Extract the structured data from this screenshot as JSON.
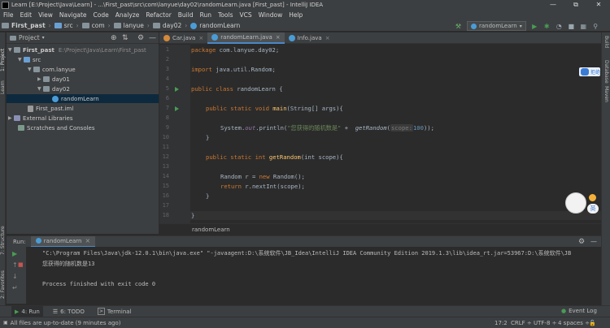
{
  "window": {
    "title": "Learn [E:\\Project\\Java\\Learn] - ...\\First_past\\src\\com\\lanyue\\day02\\randomLearn.java [First_past] - IntelliJ IDEA",
    "min": "—",
    "max": "⧉",
    "close": "✕"
  },
  "menu": [
    "File",
    "Edit",
    "View",
    "Navigate",
    "Code",
    "Analyze",
    "Refactor",
    "Build",
    "Run",
    "Tools",
    "VCS",
    "Window",
    "Help"
  ],
  "breadcrumbs": [
    "First_past",
    "src",
    "com",
    "lanyue",
    "day02",
    "randomLearn"
  ],
  "run_config": "randomLearn",
  "left_stripe": {
    "project": "1: Project",
    "learn": "Learn",
    "structure": "7: Structure",
    "favorites": "2: Favorites"
  },
  "right_stripe": {
    "ant": "Ant Build",
    "database": "Database",
    "maven": "Maven"
  },
  "project_panel": {
    "title": "Project",
    "root": "First_past",
    "root_path": "E:\\Project\\Java\\Learn\\First_past",
    "src": "src",
    "pkg": "com.lanyue",
    "day01": "day01",
    "day02": "day02",
    "file": "randomLearn",
    "iml": "First_past.iml",
    "ext": "External Libraries",
    "scratches": "Scratches and Consoles"
  },
  "tabs": [
    {
      "label": "Car.java",
      "color": "#d38a3a"
    },
    {
      "label": "randomLearn.java",
      "color": "#4a9cd6"
    },
    {
      "label": "Info.java",
      "color": "#4a9cd6"
    }
  ],
  "code": {
    "line_numbers": [
      "1",
      "2",
      "3",
      "4",
      "5",
      "6",
      "7",
      "8",
      "9",
      "10",
      "11",
      "12",
      "13",
      "14",
      "15",
      "16",
      "17",
      "18"
    ],
    "l1_kw": "package",
    "l1_rest": " com.lanyue.day02;",
    "l3_kw": "import",
    "l3_rest": " java.util.Random;",
    "l5_kw": "public class",
    "l5_rest": " randomLearn {",
    "l7_kw": "public static void",
    "l7_fn": "main",
    "l7_rest": "(String[] args){",
    "l9_a": "System.",
    "l9_out": "out",
    "l9_b": ".println(",
    "l9_str": "\"您获得的随机数是\"",
    "l9_c": " +  ",
    "l9_call": "getRandom",
    "l9_d": "(",
    "l9_hint": "scope:",
    "l9_num": "100",
    "l9_e": "));",
    "l10": "}",
    "l12_kw": "public static int",
    "l12_fn": "getRandom",
    "l12_rest": "(int scope){",
    "l14_a": "Random r = ",
    "l14_kw": "new",
    "l14_b": " Random();",
    "l15_kw": "return",
    "l15_rest": " r.nextInt(scope);",
    "l16": "}",
    "l17": "}"
  },
  "editor_breadcrumb": "randomLearn",
  "float_widget": {
    "label": "拒绝",
    "ime": "英"
  },
  "run_panel": {
    "label": "Run:",
    "tab": "randomLearn",
    "line1": "\"C:\\Program Files\\Java\\jdk-12.0.1\\bin\\java.exe\" \"-javaagent:D:\\系统软件\\JB_Idea\\IntelliJ IDEA Community Edition 2019.1.3\\lib\\idea_rt.jar=53967:D:\\系统软件\\JB",
    "line2": "您获得的随机数是13",
    "line3": "Process finished with exit code 0"
  },
  "tool_tabs": [
    "4: Run",
    "6: TODO",
    "Terminal"
  ],
  "event_log": "Event Log",
  "status": {
    "message": "All files are up-to-date (9 minutes ago)",
    "position": "17:2",
    "line_sep": "CRLF ÷",
    "encoding": "UTF-8 ÷",
    "indent": "4 spaces ÷"
  }
}
